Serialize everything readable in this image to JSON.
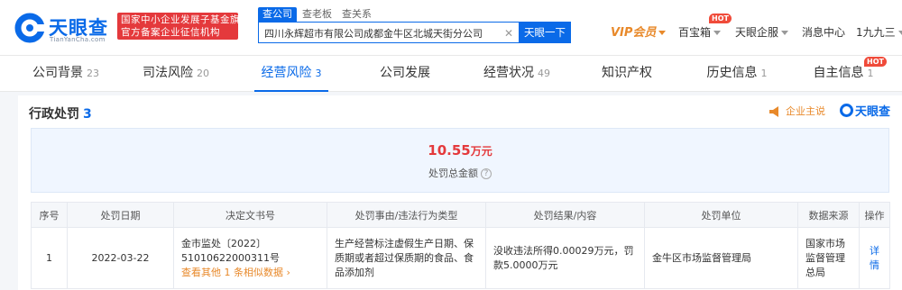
{
  "brand": {
    "name_cn": "天眼查",
    "name_en": "TianYanCha.com",
    "color": "#0a6ae8"
  },
  "gov_badge": {
    "line1": "国家中小企业发展子基金旗下",
    "line2": "官方备案企业征信机构"
  },
  "search": {
    "tabs": [
      "查公司",
      "查老板",
      "查关系"
    ],
    "value": "四川永辉超市有限公司成都金牛区北城天街分公司",
    "button": "天眼一下"
  },
  "topnav": {
    "vip": "VIP会员",
    "treasure": "百宝箱",
    "enterprise": "天眼企服",
    "messages": "消息中心",
    "user": "1九九三",
    "hot": "HOT"
  },
  "tabs": [
    {
      "label": "公司背景",
      "count": "23"
    },
    {
      "label": "司法风险",
      "count": "20"
    },
    {
      "label": "经营风险",
      "count": "3"
    },
    {
      "label": "公司发展",
      "count": ""
    },
    {
      "label": "经营状况",
      "count": "49"
    },
    {
      "label": "知识产权",
      "count": ""
    },
    {
      "label": "历史信息",
      "count": "1"
    },
    {
      "label": "自主信息",
      "count": "1"
    }
  ],
  "section": {
    "title": "行政处罚",
    "count": "3",
    "speak": "企业主说",
    "logo": "天眼查"
  },
  "summary": {
    "amount": "10.55",
    "unit": "万元",
    "label": "处罚总金额"
  },
  "table": {
    "headers": [
      "序号",
      "处罚日期",
      "决定文书号",
      "处罚事由/违法行为类型",
      "处罚结果/内容",
      "处罚单位",
      "数据来源",
      "操作"
    ],
    "rows": [
      {
        "index": "1",
        "date": "2022-03-22",
        "doc_no": "金市监处〔2022〕51010622000311号",
        "more": "查看其他 1 条相似数据 ›",
        "reason": "生产经营标注虚假生产日期、保质期或者超过保质期的食品、食品添加剂",
        "result": "没收违法所得0.00029万元，罚款5.0000万元",
        "unit": "金牛区市场监督管理局",
        "source": "国家市场监督管理总局",
        "action": "详情"
      }
    ]
  },
  "colors": {
    "accent": "#0a6ae8",
    "red": "#e4393c",
    "orange": "#e8892a"
  }
}
